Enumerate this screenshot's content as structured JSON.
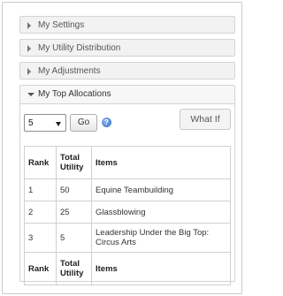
{
  "accordion": {
    "collapsed_sections": [
      {
        "label": "My Settings"
      },
      {
        "label": "My Utility Distribution"
      },
      {
        "label": "My Adjustments"
      }
    ],
    "open_section": {
      "label": "My Top Allocations"
    }
  },
  "controls": {
    "count_select_value": "5",
    "go_label": "Go",
    "help_icon": "question-circle-icon",
    "what_if_label": "What If"
  },
  "table": {
    "headers": [
      "Rank",
      "Total Utility",
      "Items"
    ],
    "rows": [
      {
        "rank": "1",
        "utility": "50",
        "item": "Equine Teambuilding"
      },
      {
        "rank": "2",
        "utility": "25",
        "item": "Glassblowing"
      },
      {
        "rank": "3",
        "utility": "5",
        "item": "Leadership Under the Big Top: Circus Arts"
      }
    ],
    "footer": [
      "Rank",
      "Total Utility",
      "Items"
    ]
  },
  "colors": {
    "border": "#d4d4d4",
    "header_bg": "#f2f2f2",
    "help_icon": "#2f6cc8"
  }
}
